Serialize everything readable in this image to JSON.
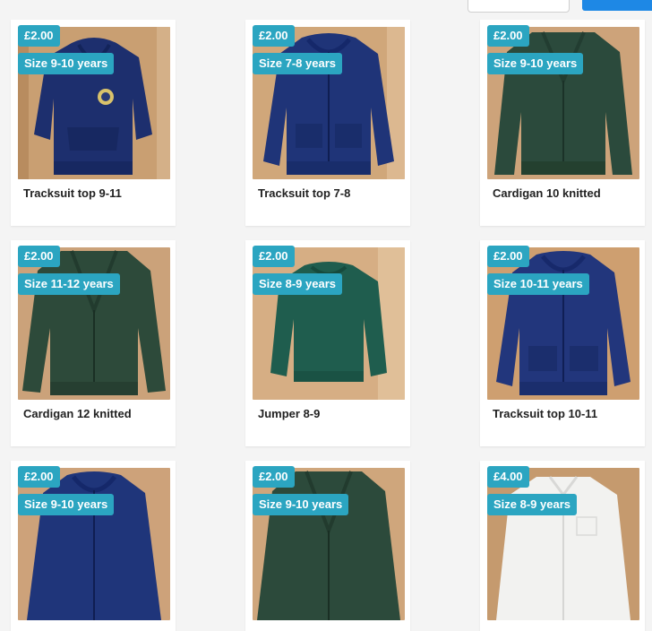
{
  "colors": {
    "badge": "#2ba5c1",
    "card_background": "#ffffff",
    "page_background": "#f4f4f4",
    "accent_button": "#1e88e5"
  },
  "listings": [
    {
      "price": "£2.00",
      "size": "Size 9-10 years",
      "title": "Tracksuit top 9-11"
    },
    {
      "price": "£2.00",
      "size": "Size 7-8 years",
      "title": "Tracksuit top 7-8"
    },
    {
      "price": "£2.00",
      "size": "Size 9-10 years",
      "title": "Cardigan 10 knitted"
    },
    {
      "price": "£2.00",
      "size": "Size 11-12 years",
      "title": "Cardigan 12 knitted"
    },
    {
      "price": "£2.00",
      "size": "Size 8-9 years",
      "title": "Jumper 8-9"
    },
    {
      "price": "£2.00",
      "size": "Size 10-11 years",
      "title": "Tracksuit top 10-11"
    },
    {
      "price": "£2.00",
      "size": "Size 9-10 years",
      "title": ""
    },
    {
      "price": "£2.00",
      "size": "Size 9-10 years",
      "title": ""
    },
    {
      "price": "£4.00",
      "size": "Size 8-9 years",
      "title": ""
    }
  ]
}
